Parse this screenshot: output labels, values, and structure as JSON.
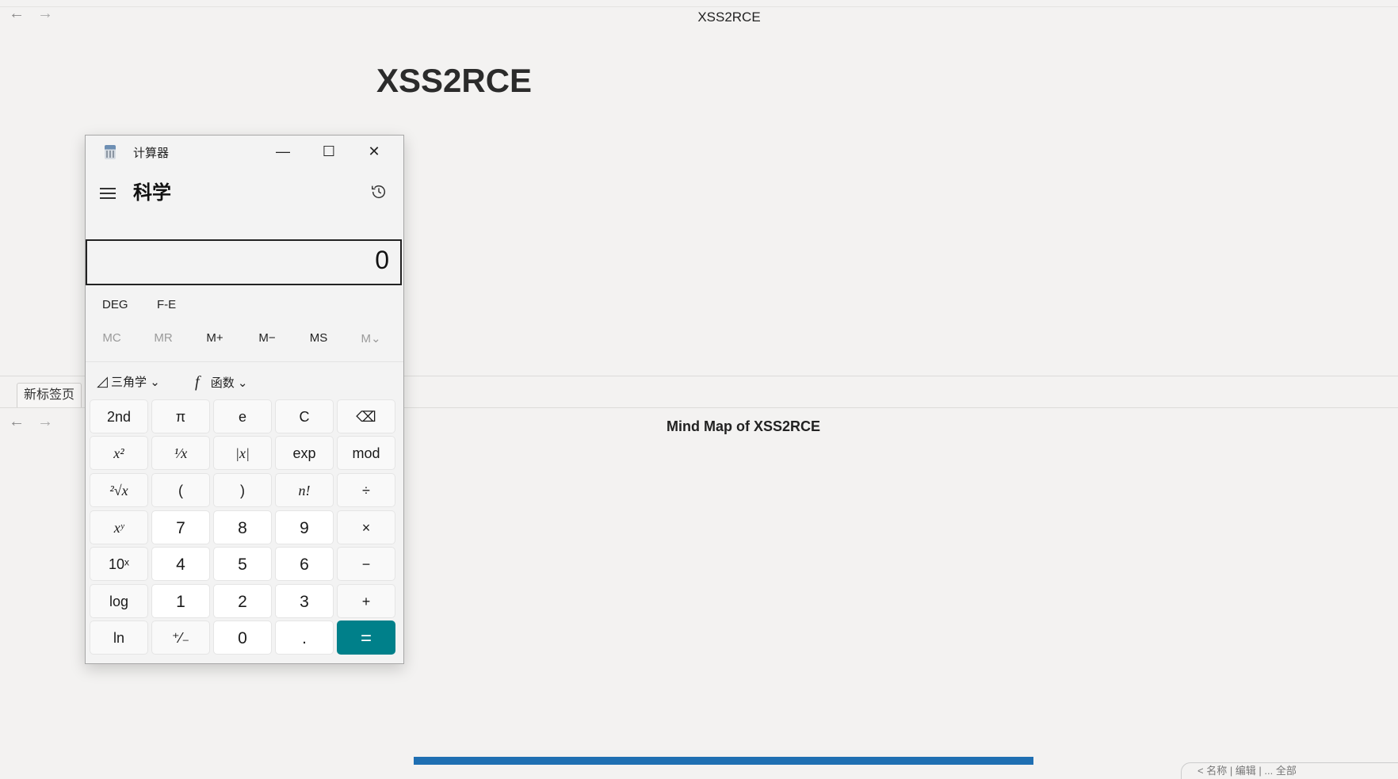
{
  "browser": {
    "window_title": "XSS2RCE",
    "tab_label": "新标签页",
    "back_icon": "←",
    "forward_icon": "→"
  },
  "document": {
    "heading": "XSS2RCE",
    "mindmap_title": "Mind Map of XSS2RCE"
  },
  "progress": {
    "fraction": 1.0,
    "color": "#1f6fb2"
  },
  "corner_widget": {
    "text": "< 名称 | 编辑 | ... 全部"
  },
  "calculator": {
    "app_title": "计算器",
    "mode": "科学",
    "window_buttons": {
      "minimize": "—",
      "maximize": "☐",
      "close": "✕"
    },
    "display_value": "0",
    "mode_buttons": [
      "DEG",
      "F-E"
    ],
    "memory_buttons": [
      {
        "label": "MC",
        "enabled": false
      },
      {
        "label": "MR",
        "enabled": false
      },
      {
        "label": "M+",
        "enabled": true
      },
      {
        "label": "M−",
        "enabled": true
      },
      {
        "label": "MS",
        "enabled": true
      },
      {
        "label": "M⌄",
        "enabled": false
      }
    ],
    "function_menus": [
      {
        "icon": "◿",
        "label": "三角学",
        "chevron": "⌄"
      },
      {
        "icon": "f",
        "label": "函数",
        "chevron": "⌄"
      }
    ],
    "keys": [
      [
        "2nd",
        "π",
        "e",
        "C",
        "⌫"
      ],
      [
        "x²",
        "¹⁄x",
        "|x|",
        "exp",
        "mod"
      ],
      [
        "²√x",
        "(",
        ")",
        "n!",
        "÷"
      ],
      [
        "xʸ",
        "7",
        "8",
        "9",
        "×"
      ],
      [
        "10ˣ",
        "4",
        "5",
        "6",
        "−"
      ],
      [
        "log",
        "1",
        "2",
        "3",
        "+"
      ],
      [
        "ln",
        "⁺⁄₋",
        "0",
        ".",
        "="
      ]
    ],
    "accent_color": "#00808a"
  }
}
